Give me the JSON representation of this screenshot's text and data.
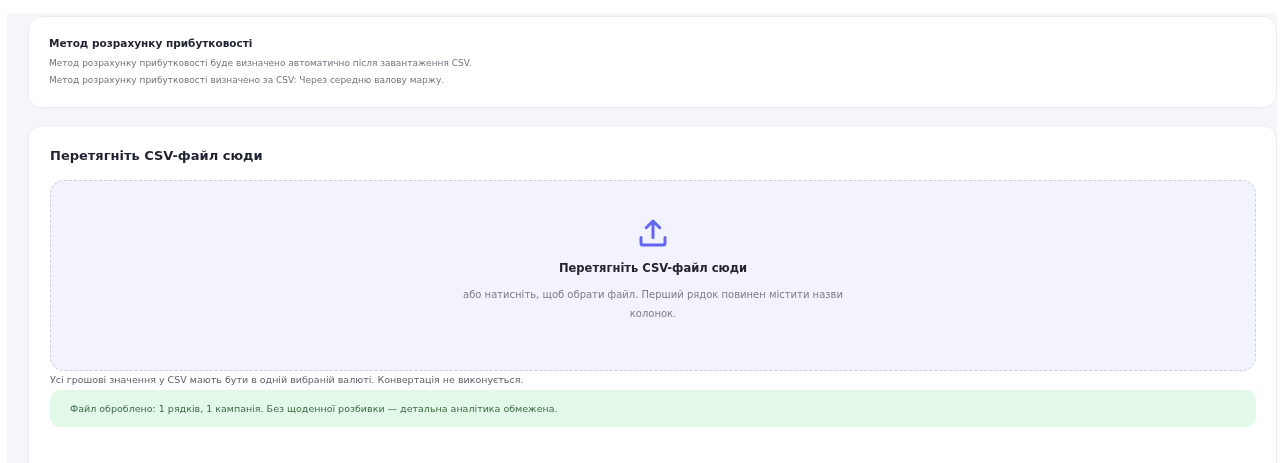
{
  "profit_method": {
    "title": "Метод розрахунку прибутковості",
    "lines": [
      "Метод розрахунку прибутковості буде визначено автоматично після завантаження CSV.",
      "Метод розрахунку прибутковості визначено за CSV: Через середню валову маржу."
    ]
  },
  "upload": {
    "title": "Перетягніть CSV-файл сюди",
    "dropzone": {
      "title": "Перетягніть CSV-файл сюди",
      "hint": "або натисніть, щоб обрати файл. Перший рядок повинен містити назви колонок."
    },
    "note": "Усі грошові значення у CSV мають бути в одній вибраній валюті. Конвертація не виконується.",
    "alert": {
      "kind": "success",
      "text": "Файл оброблено: 1 рядків, 1 кампанія. Без щоденної розбивки — детальна аналітика обмежена."
    }
  }
}
